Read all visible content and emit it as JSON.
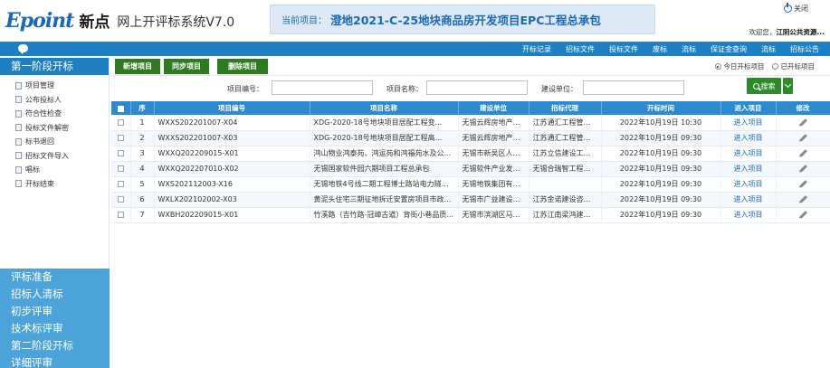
{
  "header": {
    "logo_word": "Epoint",
    "logo_cn": "新点",
    "system_name": "网上开评标系统V7.0",
    "project_label": "当前项目：",
    "project_name": "澄地2021-C-25地块商品房开发项目EPC工程总承包",
    "close_label": "关闭",
    "welcome_prefix": "欢迎您，",
    "welcome_user": "江阴公共资源..."
  },
  "navbar": {
    "items": [
      "开标记录",
      "招标文件",
      "投标文件",
      "废标",
      "流标",
      "保证金查询",
      "流标",
      "招标公告"
    ]
  },
  "sidebar": {
    "phase_title": "第一阶段开标",
    "items": [
      "项目管理",
      "公布投标人",
      "符合性检查",
      "投标文件解密",
      "标书退回",
      "招标文件导入",
      "唱标",
      "开标结束"
    ],
    "phases": [
      "评标准备",
      "招标人清标",
      "初步评审",
      "技术标评审",
      "第二阶段开标",
      "详细评审"
    ]
  },
  "toolbar": {
    "new_label": "新增项目",
    "sync_label": "同步项目",
    "delete_label": "删除项目",
    "radio_today": "今日开标项目",
    "radio_done": "已开标项目",
    "selected": "today"
  },
  "search": {
    "code_label": "项目编号：",
    "name_label": "项目名称：",
    "unit_label": "建设单位：",
    "code_value": "",
    "name_value": "",
    "unit_value": "",
    "button_label": "搜索"
  },
  "table": {
    "headers": [
      "序",
      "项目编号",
      "项目名称",
      "建设单位",
      "招标代理",
      "开标时间",
      "进入项目",
      "修改"
    ],
    "rows": [
      {
        "no": "1",
        "code": "WXXS202201007-X04",
        "name": "XDG-2020-18号地块项目居配工程变...",
        "unit": "无锡云辉房地产开...",
        "agent": "江苏通汇工程管理...",
        "time": "2022年10月19日 10:30",
        "enter": "进入项目"
      },
      {
        "no": "2",
        "code": "WXXS202201007-X03",
        "name": "XDG-2020-18号地块项目居配工程高...",
        "unit": "无锡云辉房地产开...",
        "agent": "江苏通汇工程管理...",
        "time": "2022年10月19日 09:30",
        "enter": "进入项目"
      },
      {
        "no": "3",
        "code": "WXXQ202209015-X01",
        "name": "鸿山物业鸿泰苑、鸿运苑和鸿福苑水及公...",
        "unit": "无锡市新吴区人民...",
        "agent": "江苏立信建设工程...",
        "time": "2022年10月19日 09:30",
        "enter": "进入项目"
      },
      {
        "no": "4",
        "code": "WXXQ202207010-X02",
        "name": "无锡国家软件园六期项目工程总承包",
        "unit": "无锡软件产业发展...",
        "agent": "无锡合瑞智工程咨...",
        "time": "2022年10月19日 09:30",
        "enter": "进入项目"
      },
      {
        "no": "5",
        "code": "WXS202112003-X16",
        "name": "无锡地铁4号线二期工程博士路站电力隧道...",
        "unit": "无锡地铁集团有限...",
        "agent": "",
        "time": "2022年10月19日 09:30",
        "enter": "进入项目"
      },
      {
        "no": "6",
        "code": "WXLX202102002-X03",
        "name": "黄泥头住宅三期征地拆迁安置房项目市政工...",
        "unit": "无锡市广益建设发...",
        "agent": "江苏金诺建设咨询...",
        "time": "2022年10月19日 09:30",
        "enter": "进入项目"
      },
      {
        "no": "7",
        "code": "WXBH202209015-X01",
        "name": "竹溪路（吉竹路-冠嶂古道）背街小巷品质...",
        "unit": "无锡市滨湖区马山...",
        "agent": "江苏江南梁鸿建设...",
        "time": "2022年10月19日 09:30",
        "enter": "进入项目"
      }
    ]
  },
  "icons": {
    "close": "power-icon",
    "chat": "chat-icon",
    "search": "search-icon",
    "dropdown": "chevron-down-icon",
    "edit": "pencil-icon",
    "menu": "document-icon"
  },
  "colors": {
    "brand_blue": "#1e7fc2",
    "header_blue": "#2b8ad0",
    "phase_blue": "#4ca3d9",
    "button_green": "#2d7a1f",
    "link_blue": "#1a69b6"
  }
}
